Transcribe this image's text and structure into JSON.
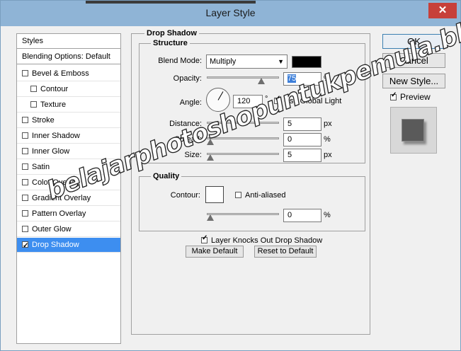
{
  "window": {
    "title": "Layer Style",
    "close_glyph": "✕"
  },
  "left_panel": {
    "header": "Styles",
    "blending": "Blending Options: Default",
    "items": [
      {
        "label": "Bevel & Emboss",
        "checked": false,
        "indent": false,
        "selected": false
      },
      {
        "label": "Contour",
        "checked": false,
        "indent": true,
        "selected": false
      },
      {
        "label": "Texture",
        "checked": false,
        "indent": true,
        "selected": false
      },
      {
        "label": "Stroke",
        "checked": false,
        "indent": false,
        "selected": false
      },
      {
        "label": "Inner Shadow",
        "checked": false,
        "indent": false,
        "selected": false
      },
      {
        "label": "Inner Glow",
        "checked": false,
        "indent": false,
        "selected": false
      },
      {
        "label": "Satin",
        "checked": false,
        "indent": false,
        "selected": false
      },
      {
        "label": "Color Overlay",
        "checked": false,
        "indent": false,
        "selected": false
      },
      {
        "label": "Gradient Overlay",
        "checked": false,
        "indent": false,
        "selected": false
      },
      {
        "label": "Pattern Overlay",
        "checked": false,
        "indent": false,
        "selected": false
      },
      {
        "label": "Outer Glow",
        "checked": false,
        "indent": false,
        "selected": false
      },
      {
        "label": "Drop Shadow",
        "checked": true,
        "indent": false,
        "selected": true
      }
    ]
  },
  "drop_shadow": {
    "group_title": "Drop Shadow",
    "structure_title": "Structure",
    "blend_mode_label": "Blend Mode:",
    "blend_mode_value": "Multiply",
    "shadow_color": "#000000",
    "opacity_label": "Opacity:",
    "opacity_value": "75",
    "opacity_unit": "%",
    "opacity_fraction": 0.75,
    "angle_label": "Angle:",
    "angle_value": "120",
    "angle_unit": "°",
    "use_global_light_label": "Use Global Light",
    "use_global_light": true,
    "distance_label": "Distance:",
    "distance_value": "5",
    "distance_unit": "px",
    "spread_label": "Spread:",
    "spread_value": "0",
    "spread_unit": "%",
    "size_label": "Size:",
    "size_value": "5",
    "size_unit": "px",
    "quality_title": "Quality",
    "contour_label": "Contour:",
    "anti_aliased_label": "Anti-aliased",
    "anti_aliased": false,
    "noise_value": "0",
    "noise_unit": "%",
    "knocks_out_label": "Layer Knocks Out Drop Shadow",
    "knocks_out": true,
    "make_default_label": "Make Default",
    "reset_default_label": "Reset to Default"
  },
  "buttons": {
    "ok": "OK",
    "cancel": "Cancel",
    "new_style": "New Style...",
    "preview_label": "Preview",
    "preview_checked": true
  },
  "watermark": "belajarphotoshopuntukpemula.blogspot.com"
}
